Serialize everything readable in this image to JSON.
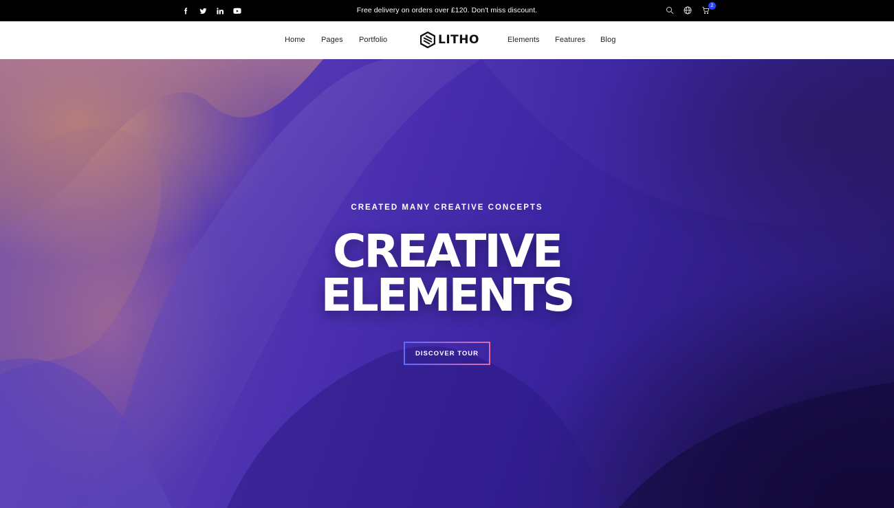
{
  "topbar": {
    "social": [
      "facebook-icon",
      "twitter-icon",
      "linkedin-icon",
      "youtube-icon"
    ],
    "announcement": "Free delivery on orders over £120. Don't miss discount.",
    "tools": [
      "search-icon",
      "globe-icon",
      "cart-icon"
    ],
    "cart_count": "2"
  },
  "nav": {
    "left": [
      "Home",
      "Pages",
      "Portfolio"
    ],
    "right": [
      "Elements",
      "Features",
      "Blog"
    ],
    "logo": "LITHO"
  },
  "hero": {
    "subtitle": "CREATED MANY CREATIVE CONCEPTS",
    "title_line1": "CREATIVE",
    "title_line2": "ELEMENTS",
    "cta": "DISCOVER TOUR"
  },
  "colors": {
    "accent_blue": "#2946f3",
    "hero_purple": "#3a24a0",
    "cta_gradient_start": "#5b6dff",
    "cta_gradient_end": "#e06ba8"
  }
}
